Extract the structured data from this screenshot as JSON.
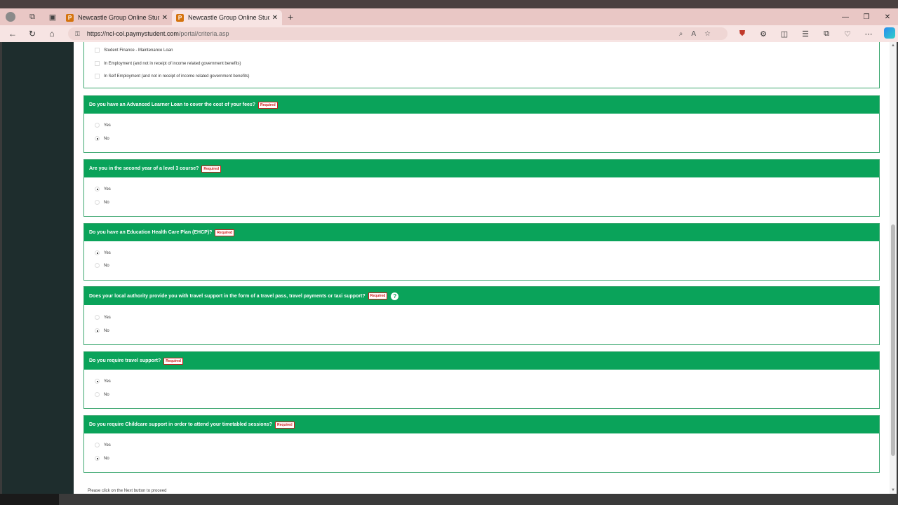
{
  "browser": {
    "tabs": [
      {
        "title": "Newcastle Group Online Student",
        "favicon": "P",
        "active": false
      },
      {
        "title": "Newcastle Group Online Student",
        "favicon": "P",
        "active": true
      }
    ],
    "url_host": "https://ncl-col.paymystudent.com",
    "url_path": "/portal/criteria.asp"
  },
  "top_panel": {
    "options": [
      {
        "label": "Student Finance - Maintenance Loan",
        "checked": false
      },
      {
        "label": "In Employment (and not in receipt of income related government benefits)",
        "checked": false
      },
      {
        "label": "In Self Employment (and not in receipt of income related government benefits)",
        "checked": false
      }
    ]
  },
  "required_label": "Required",
  "questions": [
    {
      "question": "Do you have an Advanced Learner Loan to cover the cost of your fees?",
      "help": false,
      "options": [
        {
          "label": "Yes",
          "selected": false
        },
        {
          "label": "No",
          "selected": true
        }
      ]
    },
    {
      "question": "Are you in the second year of a level 3 course?",
      "help": false,
      "options": [
        {
          "label": "Yes",
          "selected": true
        },
        {
          "label": "No",
          "selected": false
        }
      ]
    },
    {
      "question": "Do you have an Education Health Care Plan (EHCP)?",
      "help": false,
      "options": [
        {
          "label": "Yes",
          "selected": true
        },
        {
          "label": "No",
          "selected": false
        }
      ]
    },
    {
      "question": "Does your local authority provide you with travel support in the form of a travel pass, travel payments or taxi support?",
      "help": true,
      "options": [
        {
          "label": "Yes",
          "selected": false
        },
        {
          "label": "No",
          "selected": true
        }
      ]
    },
    {
      "question": "Do you require travel support?",
      "help": false,
      "options": [
        {
          "label": "Yes",
          "selected": true
        },
        {
          "label": "No",
          "selected": false
        }
      ]
    },
    {
      "question": "Do you require Childcare support in order to attend your timetabled sessions?",
      "help": false,
      "options": [
        {
          "label": "Yes",
          "selected": false
        },
        {
          "label": "No",
          "selected": true
        }
      ]
    }
  ],
  "footer_note": "Please click on the Next button to proceed",
  "help_glyph": "?",
  "colors": {
    "header_green": "#0aa35a",
    "sidebar": "#1e2d2d",
    "required_red": "#d01c1c"
  }
}
